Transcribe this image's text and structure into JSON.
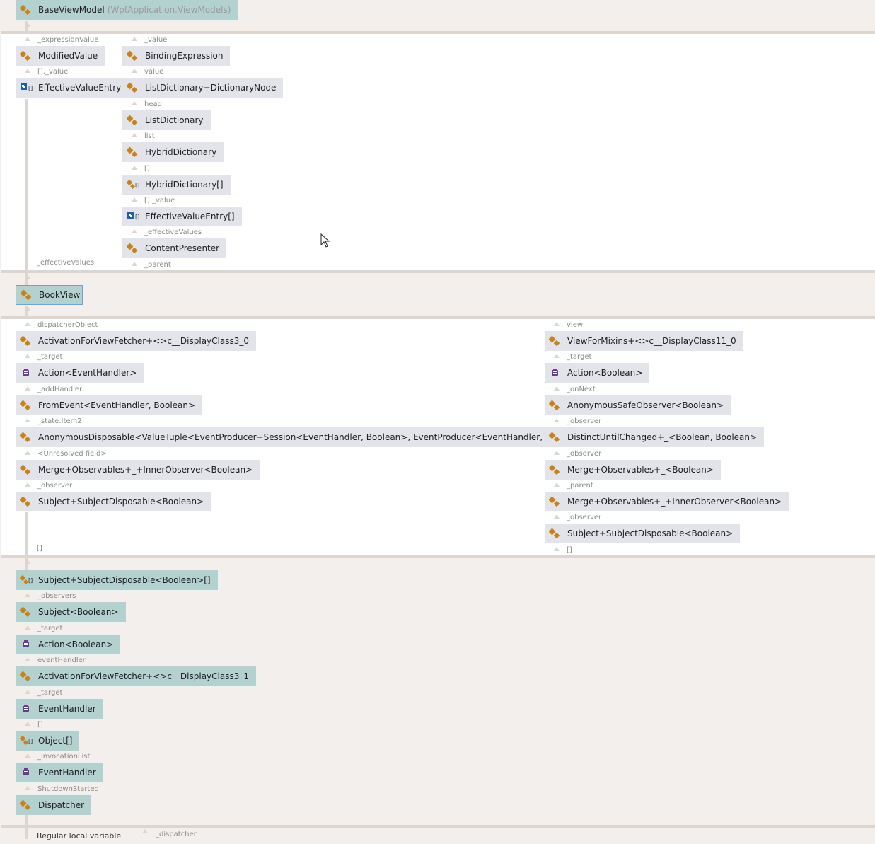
{
  "root": {
    "name": "BaseViewModel",
    "namespace": "(WpfApplication.ViewModels)"
  },
  "group1": {
    "col1": [
      {
        "label": "_expressionValue"
      },
      {
        "node": "ModifiedValue",
        "icon": "class-icon"
      },
      {
        "label": "[]._value"
      },
      {
        "node": "EffectiveValueEntry[]",
        "icon": "struct-array-icon"
      }
    ],
    "col1_bottom_label": "_effectiveValues",
    "col2": [
      {
        "label": "_value"
      },
      {
        "node": "BindingExpression",
        "icon": "class-icon"
      },
      {
        "label": "value"
      },
      {
        "node": "ListDictionary+DictionaryNode",
        "icon": "class-icon"
      },
      {
        "label": "head"
      },
      {
        "node": "ListDictionary",
        "icon": "class-icon"
      },
      {
        "label": "list"
      },
      {
        "node": "HybridDictionary",
        "icon": "class-icon"
      },
      {
        "label": "[]"
      },
      {
        "node": "HybridDictionary[]",
        "icon": "class-array-icon"
      },
      {
        "label": "[]._value"
      },
      {
        "node": "EffectiveValueEntry[]",
        "icon": "struct-array-icon"
      },
      {
        "label": "_effectiveValues"
      },
      {
        "node": "ContentPresenter",
        "icon": "class-icon"
      },
      {
        "label": "_parent"
      }
    ]
  },
  "bookview": {
    "name": "BookView"
  },
  "group2": {
    "left": [
      {
        "label": "dispatcherObject"
      },
      {
        "node": "ActivationForViewFetcher+<>c__DisplayClass3_0",
        "icon": "class-icon"
      },
      {
        "label": "_target"
      },
      {
        "node": "Action<EventHandler>",
        "icon": "delegate-icon"
      },
      {
        "label": "_addHandler"
      },
      {
        "node": "FromEvent<EventHandler, Boolean>",
        "icon": "class-icon"
      },
      {
        "label": "_state.Item2"
      },
      {
        "node": "AnonymousDisposable<ValueTuple<EventProducer+Session<EventHandler, Boolean>, EventProducer<EventHandler, Boolean>, IDisposable>>",
        "icon": "class-icon"
      },
      {
        "label": "<Unresolved field>"
      },
      {
        "node": "Merge+Observables+_+InnerObserver<Boolean>",
        "icon": "class-icon"
      },
      {
        "label": "_observer"
      },
      {
        "node": "Subject+SubjectDisposable<Boolean>",
        "icon": "class-icon"
      }
    ],
    "left_bottom_label": "[]",
    "right": [
      {
        "label": "view"
      },
      {
        "node": "ViewForMixins+<>c__DisplayClass11_0",
        "icon": "class-icon"
      },
      {
        "label": "_target"
      },
      {
        "node": "Action<Boolean>",
        "icon": "delegate-icon"
      },
      {
        "label": "_onNext"
      },
      {
        "node": "AnonymousSafeObserver<Boolean>",
        "icon": "class-icon"
      },
      {
        "label": "_observer"
      },
      {
        "node": "DistinctUntilChanged+_<Boolean, Boolean>",
        "icon": "class-icon"
      },
      {
        "label": "_observer"
      },
      {
        "node": "Merge+Observables+_<Boolean>",
        "icon": "class-icon"
      },
      {
        "label": "_parent"
      },
      {
        "node": "Merge+Observables+_+InnerObserver<Boolean>",
        "icon": "class-icon"
      },
      {
        "label": "_observer"
      },
      {
        "node": "Subject+SubjectDisposable<Boolean>",
        "icon": "class-icon"
      },
      {
        "label": "[]"
      }
    ]
  },
  "chain": [
    {
      "node": "Subject+SubjectDisposable<Boolean>[]",
      "icon": "class-array-icon"
    },
    {
      "label": "_observers"
    },
    {
      "node": "Subject<Boolean>",
      "icon": "class-icon"
    },
    {
      "label": "_target"
    },
    {
      "node": "Action<Boolean>",
      "icon": "delegate-icon"
    },
    {
      "label": "eventHandler"
    },
    {
      "node": "ActivationForViewFetcher+<>c__DisplayClass3_1",
      "icon": "class-icon"
    },
    {
      "label": "_target"
    },
    {
      "node": "EventHandler",
      "icon": "delegate-icon"
    },
    {
      "label": "[]"
    },
    {
      "node": "Object[]",
      "icon": "class-array-icon"
    },
    {
      "label": "_invocationList"
    },
    {
      "node": "EventHandler",
      "icon": "delegate-icon"
    },
    {
      "label": "ShutdownStarted"
    },
    {
      "node": "Dispatcher",
      "icon": "class-icon"
    }
  ],
  "footer": {
    "left": "Regular local variable",
    "right": "_dispatcher"
  },
  "colors": {
    "class": "#c8811b",
    "delegate": "#6c3b8f",
    "struct": "#1c5fa8",
    "selected_border": "#6fa3d6"
  }
}
